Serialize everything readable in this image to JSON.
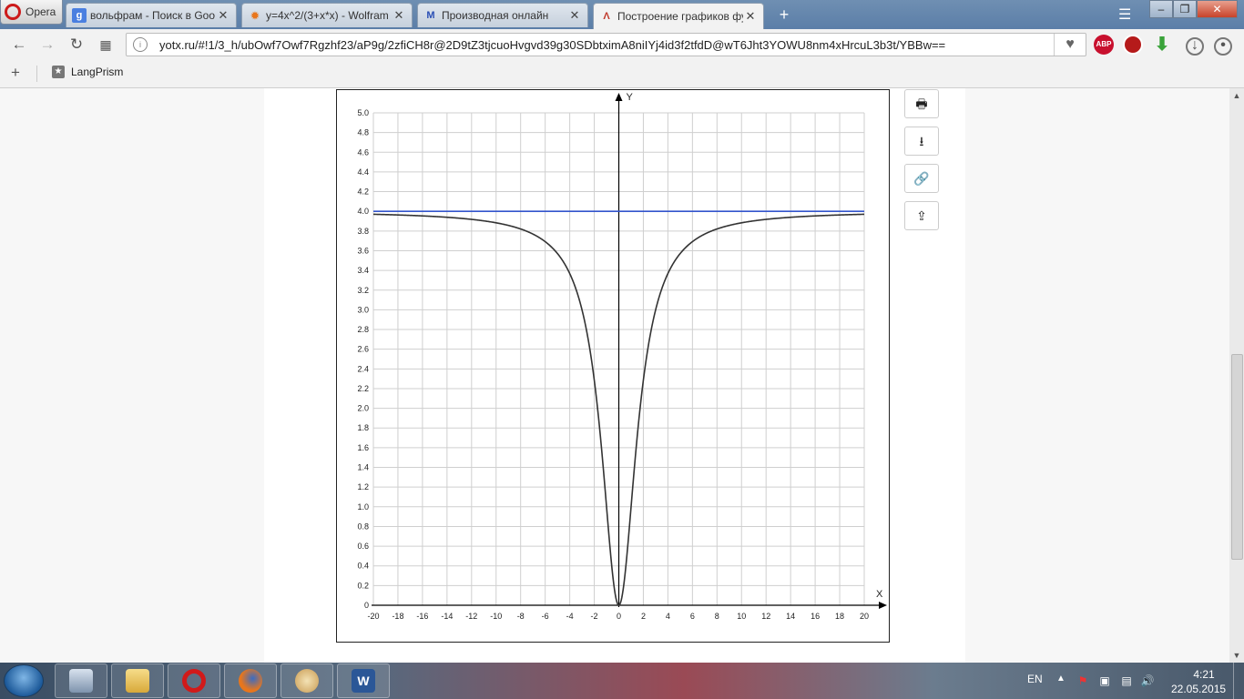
{
  "browser": {
    "menu_label": "Opera",
    "tabs": [
      {
        "title": "вольфрам - Поиск в Goo",
        "favicon": "google-icon",
        "close": "✕",
        "active": false
      },
      {
        "title": "y=4x^2/(3+x*x) - Wolfram",
        "favicon": "wolfram-icon",
        "close": "✕",
        "active": false
      },
      {
        "title": "Производная онлайн",
        "favicon": "mathcabinet-icon",
        "close": "✕",
        "active": false
      },
      {
        "title": "Построение графиков фу",
        "favicon": "yotx-icon",
        "close": "✕",
        "active": true
      }
    ],
    "new_tab": "+",
    "url": "yotx.ru/#!1/3_h/ubOwf7Owf7Rgzhf23/aP9g/2zfiCH8r@2D9tZ3tjcuoHvgvd39g30SDbtximA8niIYj4id3f2tfdD@wT6Jht3YOWU8nm4xHrcuL3b3t/YBBw==",
    "bookmark_label": "LangPrism",
    "extensions": [
      {
        "name": "adblock-icon",
        "label": "ABP"
      },
      {
        "name": "adguard-icon",
        "label": ""
      },
      {
        "name": "download-extension-icon",
        "label": ""
      }
    ]
  },
  "graph": {
    "x_axis_name": "X",
    "y_axis_name": "Y",
    "x_ticks": [
      "-20",
      "-18",
      "-16",
      "-14",
      "-12",
      "-10",
      "-8",
      "-6",
      "-4",
      "-2",
      "0",
      "2",
      "4",
      "6",
      "8",
      "10",
      "12",
      "14",
      "16",
      "18",
      "20"
    ],
    "y_ticks": [
      "0",
      "0.2",
      "0.4",
      "0.6",
      "0.8",
      "1.0",
      "1.2",
      "1.4",
      "1.6",
      "1.8",
      "2.0",
      "2.2",
      "2.4",
      "2.6",
      "2.8",
      "3.0",
      "3.2",
      "3.4",
      "3.6",
      "3.8",
      "4.0",
      "4.2",
      "4.4",
      "4.6",
      "4.8",
      "5.0"
    ]
  },
  "chart_data": {
    "type": "line",
    "title": "",
    "xlabel": "X",
    "ylabel": "Y",
    "xlim": [
      -20,
      20
    ],
    "ylim": [
      0,
      5
    ],
    "grid": true,
    "series": [
      {
        "color": "#333333",
        "function": "y=4x^2/(3+x*x)",
        "x": [
          -20,
          -16,
          -12,
          -10,
          -8,
          -6,
          -4,
          -3,
          -2,
          -1,
          0,
          1,
          2,
          3,
          4,
          6,
          8,
          10,
          12,
          16,
          20
        ],
        "y": [
          3.971,
          3.955,
          3.922,
          3.884,
          3.824,
          3.692,
          3.368,
          3.0,
          2.286,
          1.0,
          0,
          1.0,
          2.286,
          3.0,
          3.368,
          3.692,
          3.824,
          3.884,
          3.922,
          3.955,
          3.971
        ]
      },
      {
        "color": "#3355cc",
        "function": "y=4",
        "x": [
          -20,
          20
        ],
        "y": [
          4,
          4
        ]
      }
    ]
  },
  "side_buttons": [
    {
      "name": "print-button",
      "icon": "🖶"
    },
    {
      "name": "download-button",
      "icon": "⭳"
    },
    {
      "name": "link-button",
      "icon": "🔗"
    },
    {
      "name": "share-button",
      "icon": "⇪"
    }
  ],
  "taskbar": {
    "apps": [
      "calculator-icon",
      "explorer-icon",
      "opera-icon",
      "firefox-icon",
      "paint-icon",
      "word-icon"
    ],
    "language": "EN",
    "time": "4:21",
    "date": "22.05.2015"
  }
}
